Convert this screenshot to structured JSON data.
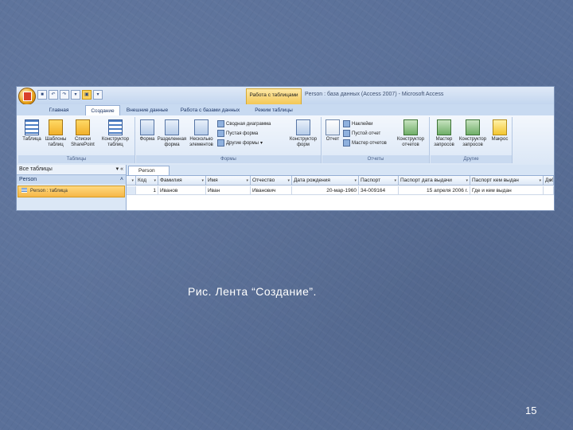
{
  "window": {
    "context_tab": "Работа с таблицами",
    "app_title": "Person : база данных (Access 2007) - Microsoft Access"
  },
  "ribbon_tabs": [
    "Главная",
    "Создание",
    "Внешние данные",
    "Работа с базами данных",
    "Режим таблицы"
  ],
  "ribbon": {
    "tables": {
      "label": "Таблицы",
      "buttons": [
        "Таблица",
        "Шаблоны таблиц",
        "Списки SharePoint",
        "Конструктор таблиц"
      ]
    },
    "forms": {
      "label": "Формы",
      "buttons": [
        "Форма",
        "Разделенная форма",
        "Несколько элементов"
      ],
      "small": [
        "Сводная диаграмма",
        "Пустая форма",
        "Другие формы"
      ],
      "designer": "Конструктор форм"
    },
    "reports": {
      "label": "Отчеты",
      "button": "Отчет",
      "small": [
        "Наклейки",
        "Пустой отчет",
        "Мастер отчетов"
      ],
      "designer": "Конструктор отчетов"
    },
    "other": {
      "label": "Другие",
      "buttons": [
        "Мастер запросов",
        "Конструктор запросов",
        "Макрос"
      ]
    }
  },
  "nav_pane": {
    "header": "Все таблицы",
    "group": "Person",
    "item": "Person : таблица"
  },
  "document": {
    "tab": "Person",
    "columns": [
      "Код",
      "Фамилия",
      "Имя",
      "Отчество",
      "Дата рождения",
      "Паспорт",
      "Паспорт дата выдачи",
      "Паспорт кем выдан",
      "Добавит"
    ],
    "rows": [
      [
        "1",
        "Иванов",
        "Иван",
        "Иванович",
        "20-мар-1960",
        "34-009164",
        "15 апреля 2006 г.",
        "Где и кем выдан",
        ""
      ]
    ]
  },
  "slide": {
    "caption": "Рис. Лента “Создание”.",
    "page_number": "15"
  }
}
